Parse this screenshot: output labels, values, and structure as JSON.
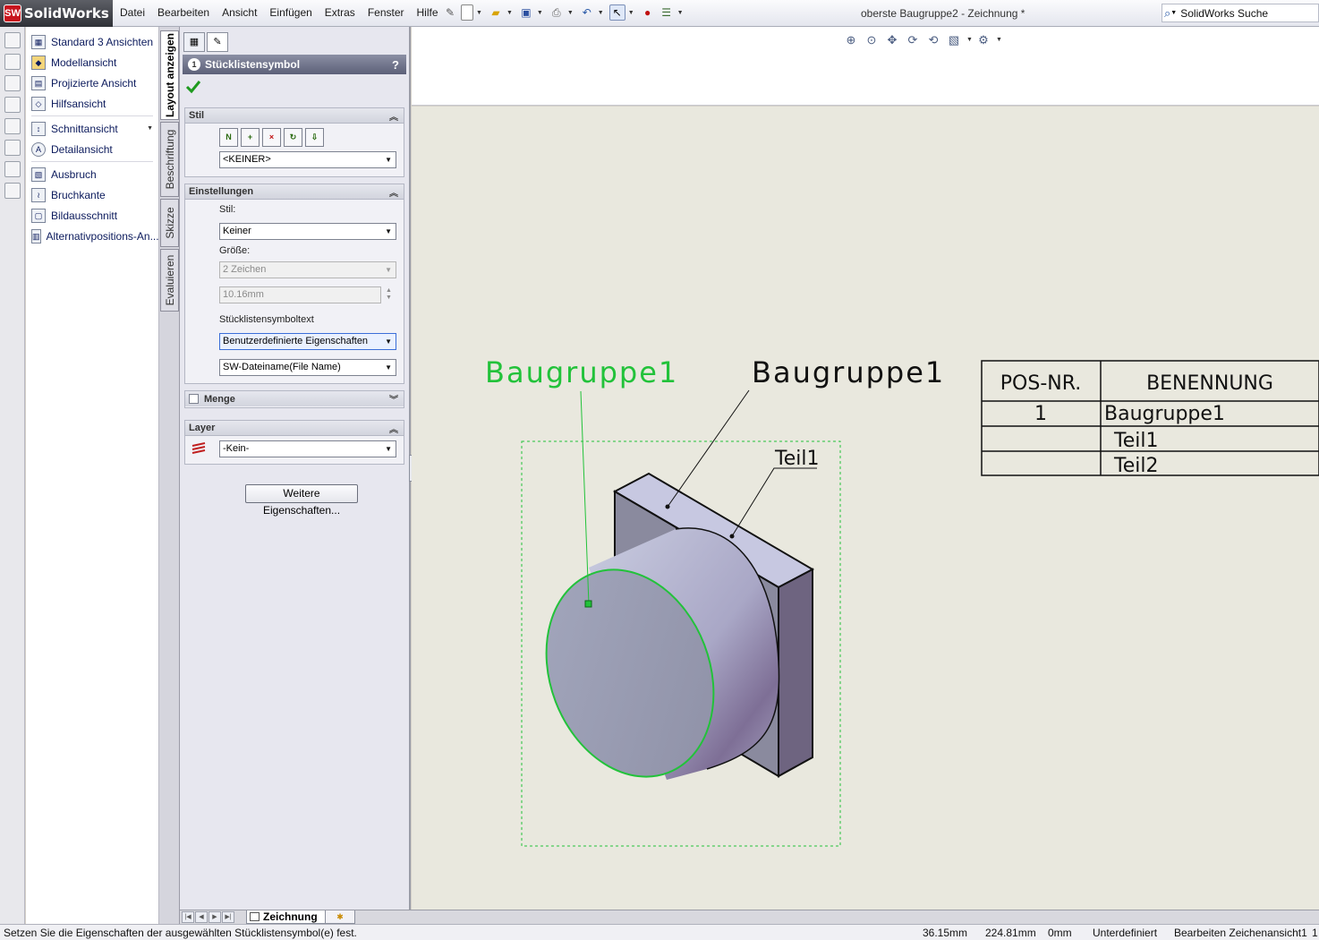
{
  "app": {
    "logo_mark": "SW",
    "logo_text": "SolidWorks",
    "menu": [
      "Datei",
      "Bearbeiten",
      "Ansicht",
      "Einfügen",
      "Extras",
      "Fenster",
      "Hilfe"
    ],
    "document_title": "oberste Baugruppe2 - Zeichnung *",
    "search_placeholder": "SolidWorks Suche"
  },
  "command_list": {
    "items": [
      {
        "label": "Standard 3 Ansichten",
        "icon": "standard-views-icon"
      },
      {
        "label": "Modellansicht",
        "icon": "model-view-icon"
      },
      {
        "label": "Projizierte Ansicht",
        "icon": "projected-view-icon"
      },
      {
        "label": "Hilfsansicht",
        "icon": "auxiliary-view-icon"
      },
      {
        "label": "Schnittansicht",
        "icon": "section-view-icon"
      },
      {
        "label": "Detailansicht",
        "icon": "detail-view-icon"
      },
      {
        "label": "Ausbruch",
        "icon": "broken-out-section-icon"
      },
      {
        "label": "Bruchkante",
        "icon": "break-line-icon"
      },
      {
        "label": "Bildausschnitt",
        "icon": "crop-view-icon"
      },
      {
        "label": "Alternativpositions-An...",
        "icon": "alternate-position-icon"
      }
    ]
  },
  "vertical_tabs": [
    "Layout anzeigen",
    "Beschriftung",
    "Skizze",
    "Evaluieren"
  ],
  "property_manager": {
    "title": "Stücklistensymbol",
    "help": "?",
    "groups": {
      "stil": {
        "title": "Stil",
        "select_value": "<KEINER>",
        "buttons": [
          "N",
          "+",
          "×",
          "↻",
          "⇩"
        ]
      },
      "einstellungen": {
        "title": "Einstellungen",
        "stil_label": "Stil:",
        "stil_value": "Keiner",
        "groesse_label": "Größe:",
        "groesse_value": "2 Zeichen",
        "size_value": "10.16mm",
        "text_label": "Stücklistensymboltext",
        "text_value": "Benutzerdefinierte Eigenschaften",
        "property_value": "SW-Dateiname(File Name)"
      },
      "menge": {
        "title": "Menge",
        "checked": false
      },
      "layer": {
        "title": "Layer",
        "value": "-Kein-"
      }
    },
    "more_button": "Weitere Eigenschaften..."
  },
  "drawing": {
    "balloon_selected": "Baugruppe1",
    "balloon_assembly": "Baugruppe1",
    "balloon_part": "Teil1",
    "colors": {
      "selected": "#22c23a",
      "line": "#111111",
      "sheet": "#e9e8de"
    }
  },
  "bom_table": {
    "headers": [
      "POS-NR.",
      "BENENNUNG"
    ],
    "rows": [
      {
        "pos": "1",
        "name": "Baugruppe1"
      },
      {
        "pos": "",
        "name": "Teil1"
      },
      {
        "pos": "",
        "name": "Teil2"
      }
    ]
  },
  "sheet_tabs": {
    "active": "Zeichnung"
  },
  "status_bar": {
    "message": "Setzen Sie die Eigenschaften der ausgewählten Stücklistensymbol(e) fest.",
    "x": "36.15mm",
    "y": "224.81mm",
    "z": "0mm",
    "state": "Unterdefiniert",
    "mode": "Bearbeiten Zeichenansicht1",
    "extra": "1"
  }
}
